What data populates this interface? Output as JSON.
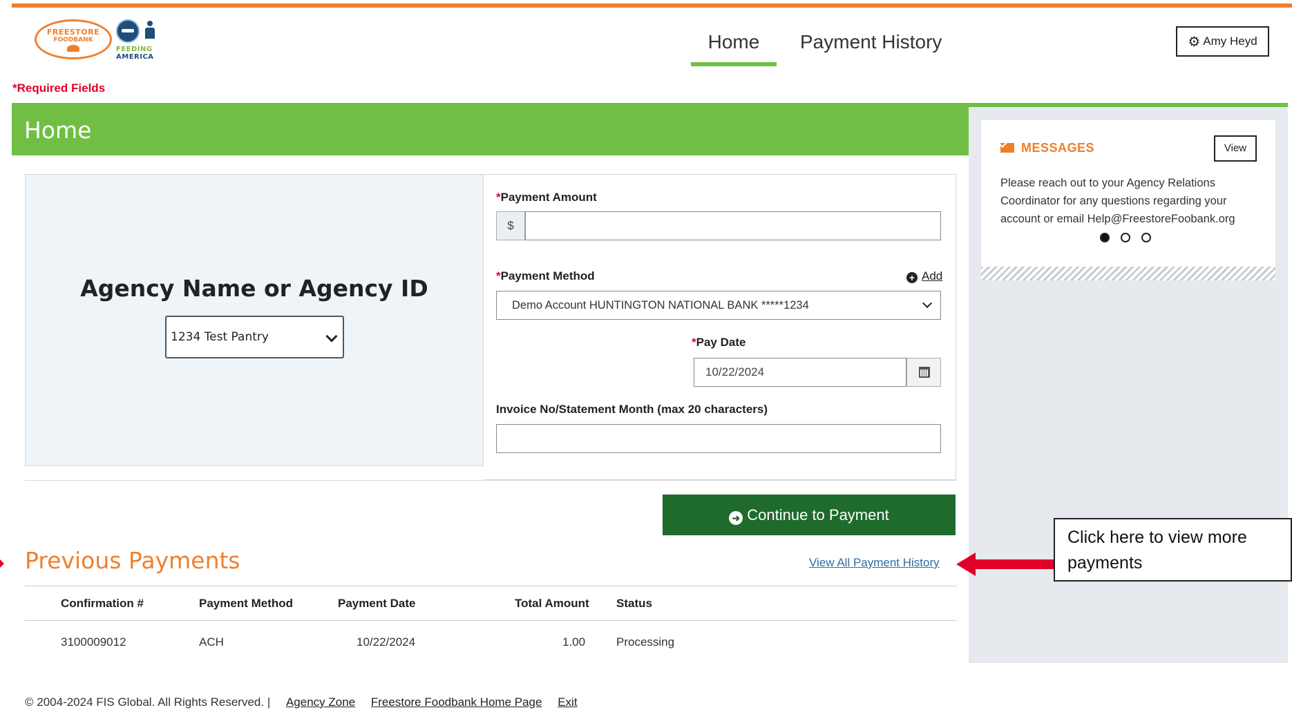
{
  "logo": {
    "line1": "FREESTORE",
    "line2": "FOODBANK",
    "partner1": "FEEDING",
    "partner2": "AMERICA"
  },
  "nav": {
    "home": "Home",
    "payment_history": "Payment History",
    "user": "Amy Heyd"
  },
  "required_marker": "*",
  "required_fields": "Required Fields",
  "page_title": "Home",
  "messages": {
    "title": "MESSAGES",
    "view_label": "View",
    "text": "Please reach out to your Agency Relations Coordinator for any questions regarding your account or email Help@FreestoreFoobank.org",
    "active_slide": 1,
    "slide_count": 3
  },
  "agency": {
    "label": "Agency Name or Agency ID",
    "selected": "1234 Test Pantry"
  },
  "form": {
    "amount_label": "Payment Amount",
    "currency_symbol": "$",
    "amount_value": "",
    "method_label": "Payment Method",
    "add_label": "Add",
    "method_selected": "Demo Account HUNTINGTON NATIONAL BANK *****1234",
    "paydate_label": "Pay Date",
    "paydate_value": "10/22/2024",
    "invoice_label": "Invoice No/Statement Month (max 20 characters)",
    "invoice_value": ""
  },
  "continue_label": "Continue to Payment",
  "previous": {
    "title": "Previous Payments",
    "view_all": "View All Payment History",
    "columns": [
      "Confirmation #",
      "Payment Method",
      "Payment Date",
      "Total Amount",
      "Status"
    ],
    "rows": [
      [
        "3100009012",
        "ACH",
        "10/22/2024",
        "1.00",
        "Processing"
      ]
    ]
  },
  "callout": "Click here to view more payments",
  "footer": {
    "copyright": "© 2004-2024 FIS Global. All Rights Reserved. |",
    "links": [
      "Agency Zone",
      "Freestore Foodbank Home Page",
      "Exit"
    ]
  },
  "colors": {
    "accent_orange": "#f07f2c",
    "header_green": "#70bf44",
    "button_green": "#1e6b2c",
    "required_red": "#e0002a"
  }
}
